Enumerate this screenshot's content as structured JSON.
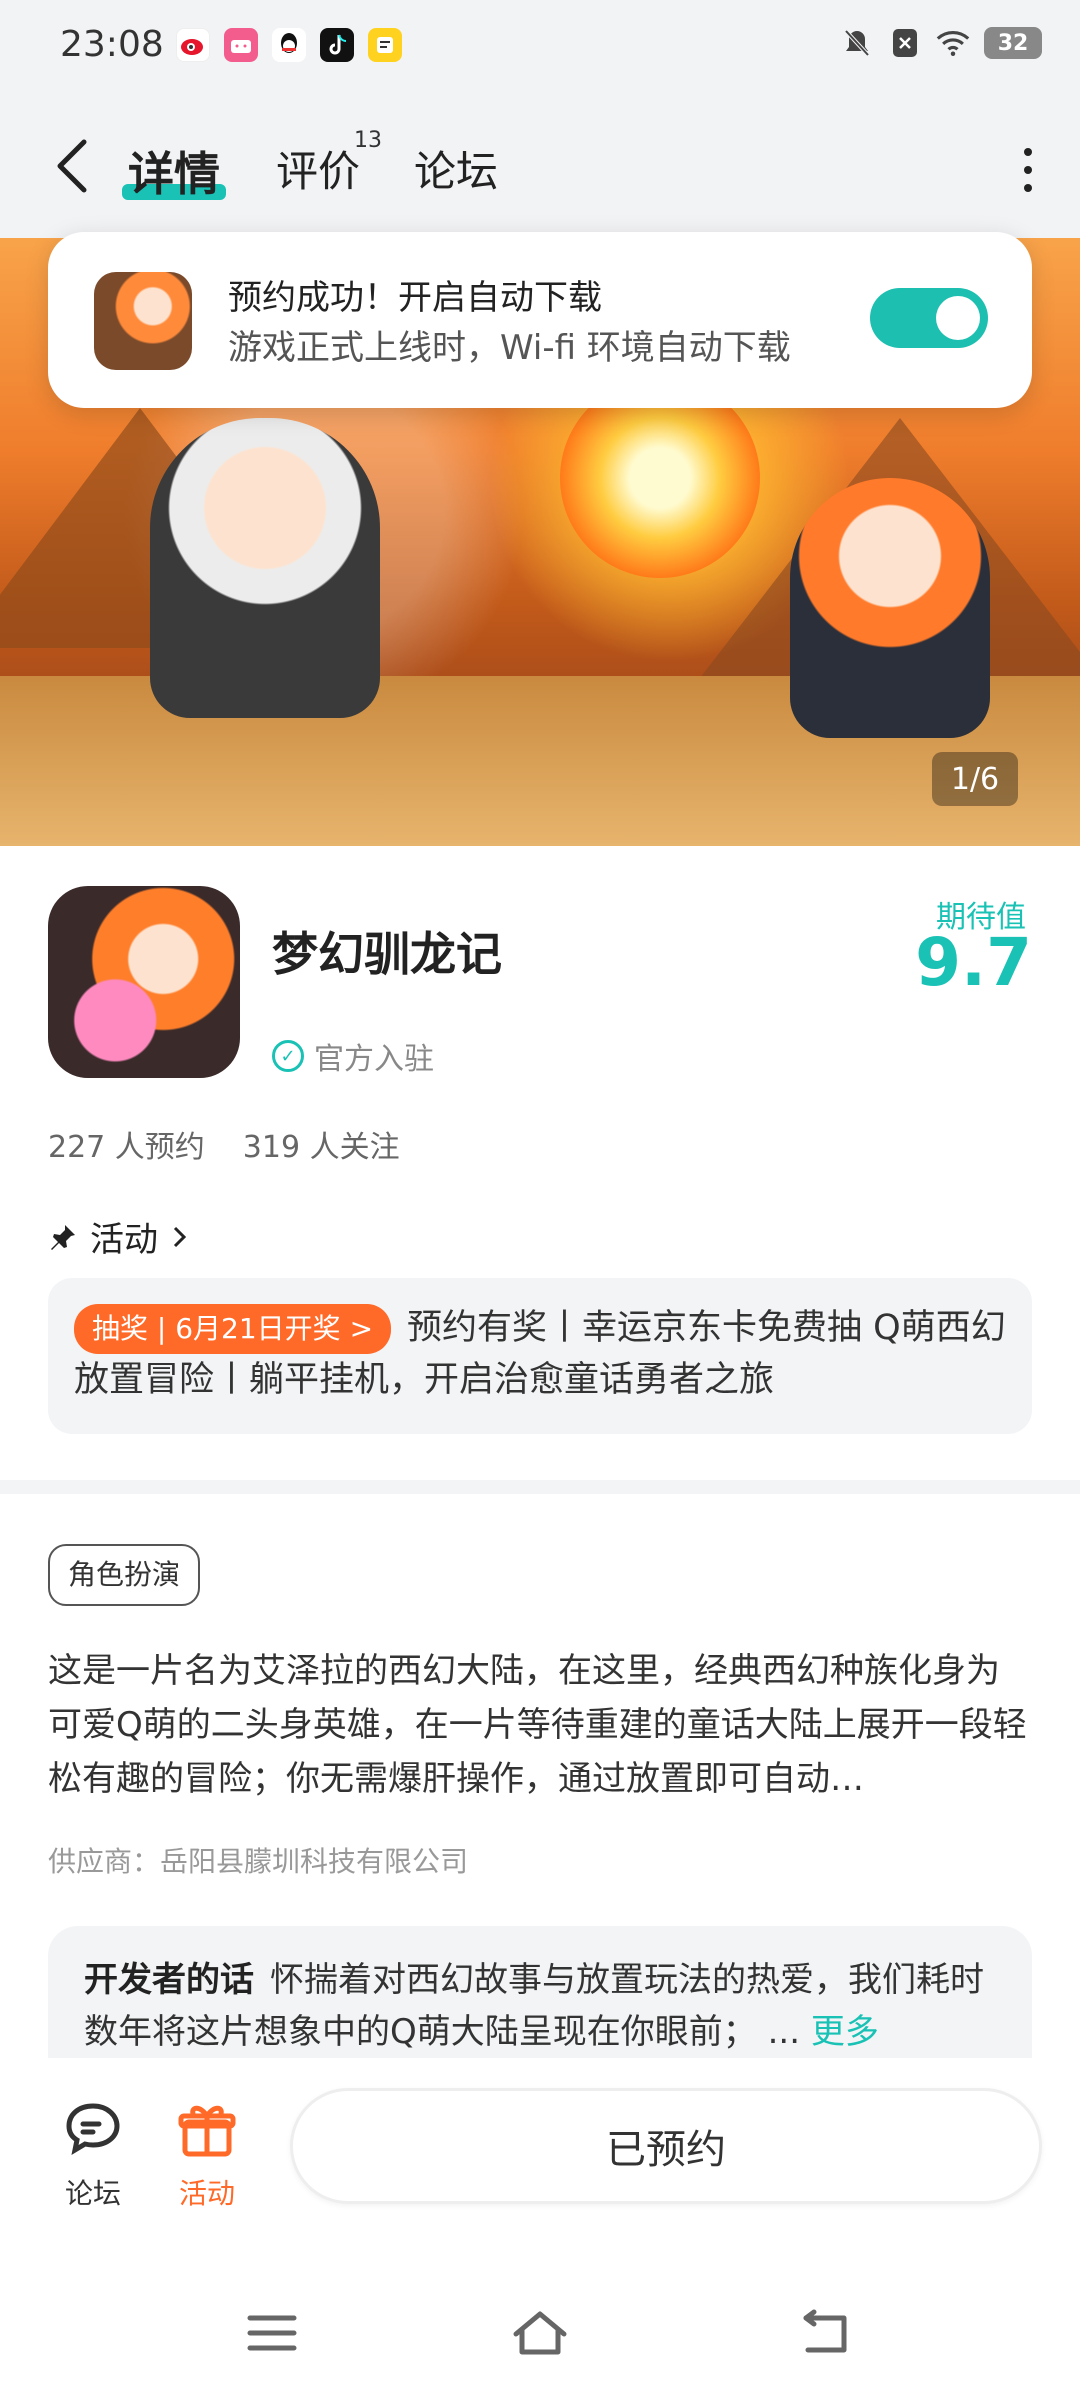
{
  "status_bar": {
    "time": "23:08",
    "battery": "32",
    "app_icons": [
      "weibo-icon",
      "bilibili-icon",
      "qq-icon",
      "tiktok-icon",
      "notes-icon"
    ]
  },
  "nav": {
    "tabs": [
      {
        "label": "详情",
        "active": true
      },
      {
        "label": "评价",
        "badge": "13"
      },
      {
        "label": "论坛"
      }
    ]
  },
  "banner": {
    "counter": "1/6"
  },
  "toast": {
    "title": "预约成功！开启自动下载",
    "subtitle": "游戏正式上线时，Wi-fi 环境自动下载",
    "switch_on": true,
    "accent": "#1dbfb0"
  },
  "app": {
    "name": "梦幻驯龙记",
    "official_label": "官方入驻",
    "score_label": "期待值",
    "score": "9.7",
    "reservations": "227 人预约",
    "followers": "319 人关注"
  },
  "activity": {
    "title": "活动",
    "tag": "抽奖 | 6月21日开奖 >",
    "text": "预约有奖丨幸运京东卡免费抽 Q萌西幻放置冒险丨躺平挂机，开启治愈童话勇者之旅"
  },
  "details": {
    "genre": "角色扮演",
    "description": "这是一片名为艾泽拉的西幻大陆，在这里，经典西幻种族化身为可爱Q萌的二头身英雄，在一片等待重建的童话大陆上展开一段轻松有趣的冒险；你无需爆肝操作，通过放置即可自动…",
    "supplier": "供应商：岳阳县朦圳科技有限公司"
  },
  "developer": {
    "label": "开发者的话",
    "text": "怀揣着对西幻故事与放置玩法的热爱，我们耗时数年将这片想象中的Q萌大陆呈现在你眼前；",
    "ellipsis": "...",
    "more": "更多"
  },
  "bottom_bar": {
    "forum_label": "论坛",
    "activity_label": "活动",
    "reserved_label": "已预约",
    "activity_color": "#ff6a28"
  }
}
